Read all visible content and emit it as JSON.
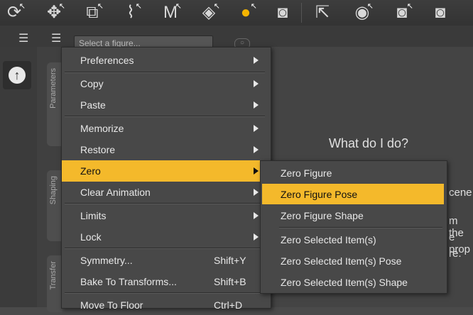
{
  "toolbar": {
    "icons": [
      "rotate-icon",
      "move-icon",
      "scale-icon",
      "bone-icon",
      "morph-icon",
      "surface-icon",
      "figure-icon",
      "camera-icon",
      "pointer-icon",
      "node-icon",
      "camera-edit-icon",
      "camera-frame-icon"
    ]
  },
  "row2": {
    "selector_value": "Select a figure..."
  },
  "side_tabs": [
    "Parameters",
    "Shaping",
    "Transfer"
  ],
  "main": {
    "help_title": "What do I do?",
    "fragments": [
      "cene",
      "m the",
      "e prop",
      "re."
    ]
  },
  "menu": {
    "items": [
      {
        "label": "Preferences",
        "submenu": true
      },
      {
        "label": "Copy",
        "submenu": true
      },
      {
        "label": "Paste",
        "submenu": true
      },
      {
        "label": "Memorize",
        "submenu": true
      },
      {
        "label": "Restore",
        "submenu": true
      },
      {
        "label": "Zero",
        "submenu": true,
        "highlighted": true
      },
      {
        "label": "Clear Animation",
        "submenu": true
      },
      {
        "label": "Limits",
        "submenu": true
      },
      {
        "label": "Lock",
        "submenu": true
      },
      {
        "label": "Symmetry...",
        "shortcut": "Shift+Y"
      },
      {
        "label": "Bake To Transforms...",
        "shortcut": "Shift+B"
      },
      {
        "label": "Move To Floor",
        "shortcut": "Ctrl+D"
      }
    ]
  },
  "submenu": {
    "items": [
      {
        "label": "Zero Figure"
      },
      {
        "label": "Zero Figure Pose",
        "highlighted": true
      },
      {
        "label": "Zero Figure Shape"
      },
      {
        "label": "Zero Selected Item(s)"
      },
      {
        "label": "Zero Selected Item(s) Pose"
      },
      {
        "label": "Zero Selected Item(s) Shape"
      }
    ]
  },
  "colors": {
    "highlight": "#f4b92b",
    "menu_bg": "#484848",
    "toolbar_bg": "#333333"
  }
}
